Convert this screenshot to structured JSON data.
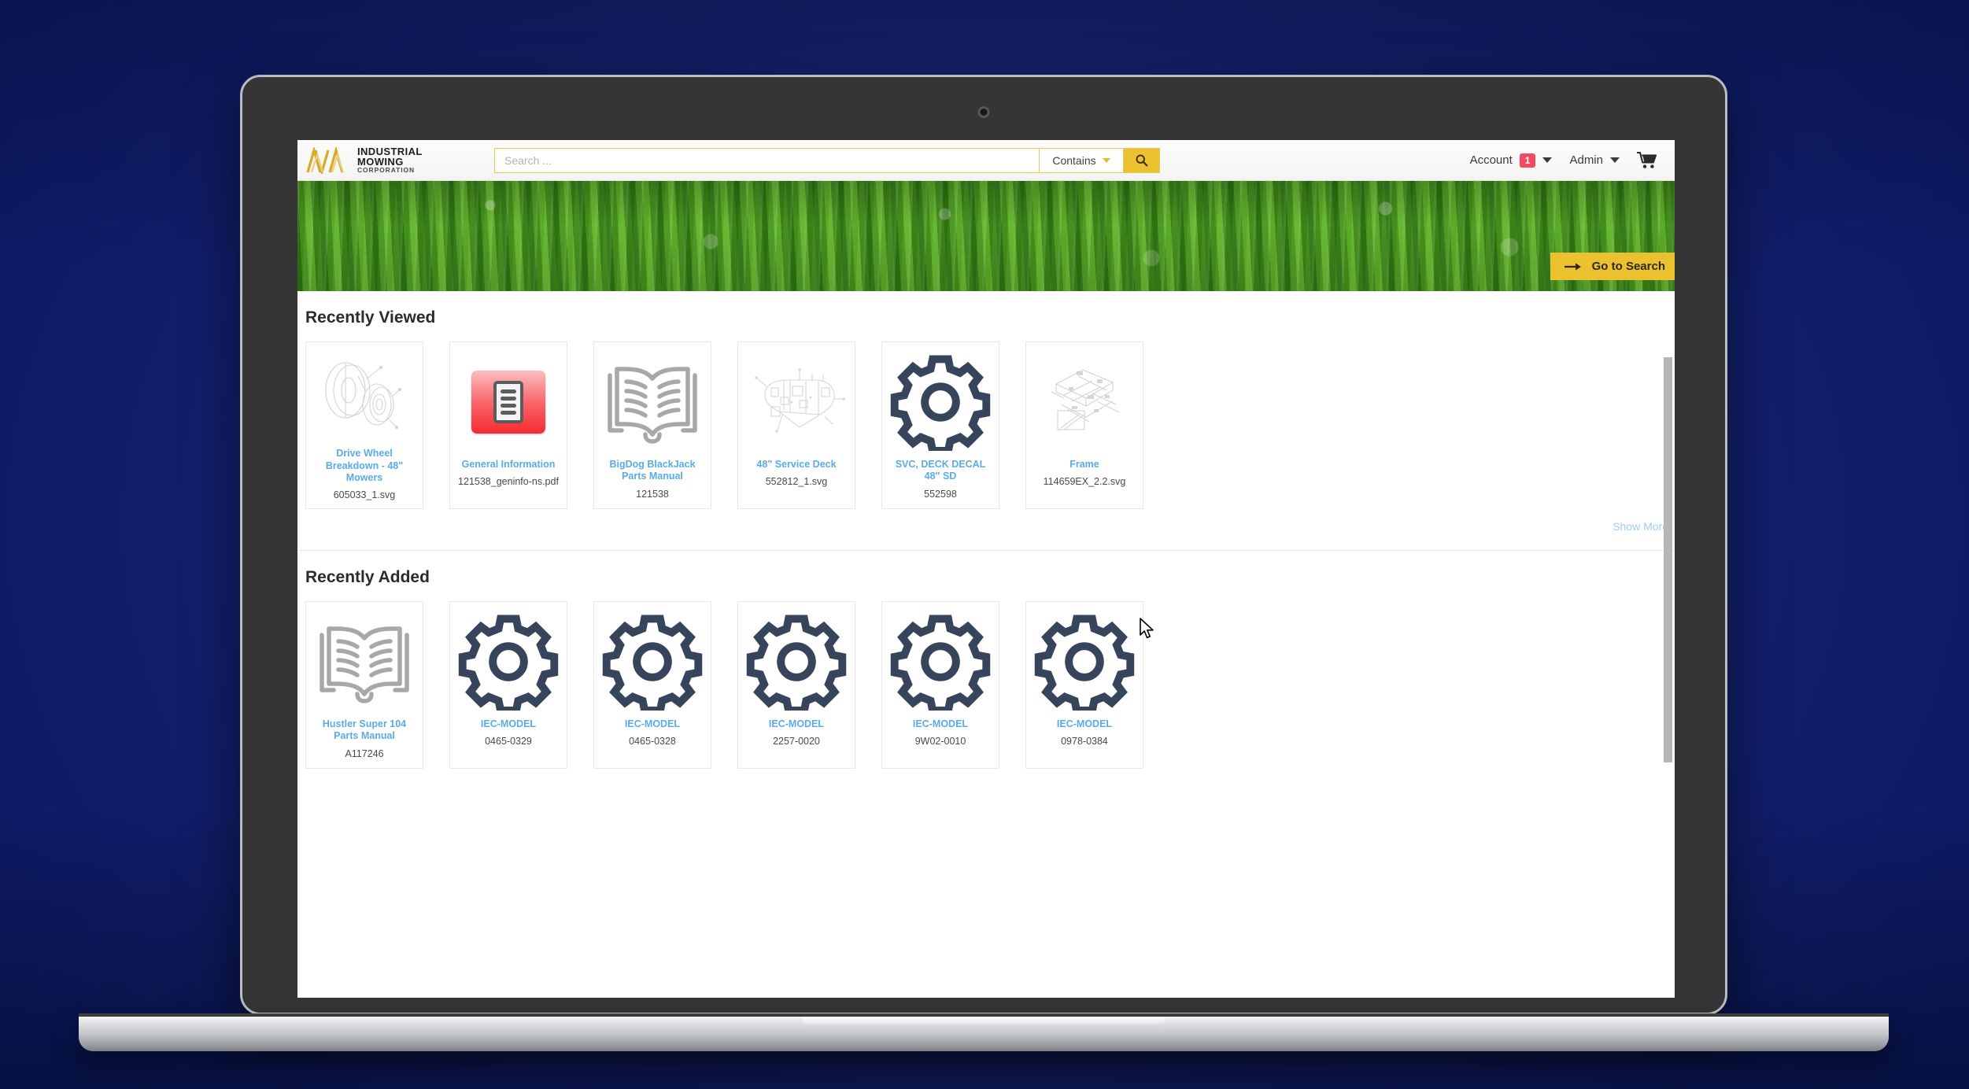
{
  "header": {
    "logo": {
      "line1": "INDUSTRIAL",
      "line2": "MOWING",
      "line3": "CORPORATION",
      "mark": "ava-chevrons-logo",
      "color": "#d9a92b"
    },
    "search": {
      "placeholder": "Search ...",
      "value": "",
      "match_mode": "Contains",
      "search_icon": "magnifier-icon",
      "accent": "#ecc12f"
    },
    "account": {
      "label": "Account",
      "badge": "1",
      "badge_color": "#f24a63"
    },
    "admin": {
      "label": "Admin"
    },
    "cart": {
      "icon": "shopping-cart-icon"
    }
  },
  "banner": {
    "image": "green-grass-dew-photo",
    "cta_label": "Go to Search",
    "cta_icon": "arrow-right-icon",
    "cta_color": "#ecc12f"
  },
  "sections": [
    {
      "title": "Recently Viewed",
      "show_more": "Show More",
      "cards": [
        {
          "title": "Drive Wheel Breakdown - 48\" Mowers",
          "sub": "605033_1.svg",
          "icon": "line-drawing-wheel"
        },
        {
          "title": "General Information",
          "sub": "121538_geninfo-ns.pdf",
          "icon": "pdf-document-icon"
        },
        {
          "title": "BigDog BlackJack Parts Manual",
          "sub": "121538",
          "icon": "open-book-icon"
        },
        {
          "title": "48\" Service Deck",
          "sub": "552812_1.svg",
          "icon": "line-drawing-deck"
        },
        {
          "title": "SVC, DECK DECAL 48\" SD",
          "sub": "552598",
          "icon": "gear-icon"
        },
        {
          "title": "Frame",
          "sub": "114659EX_2.2.svg",
          "icon": "line-drawing-frame"
        }
      ]
    },
    {
      "title": "Recently Added",
      "show_more": "",
      "cards": [
        {
          "title": "Hustler Super 104 Parts Manual",
          "sub": "A117246",
          "icon": "open-book-icon"
        },
        {
          "title": "IEC-MODEL",
          "sub": "0465-0329",
          "icon": "gear-icon"
        },
        {
          "title": "IEC-MODEL",
          "sub": "0465-0328",
          "icon": "gear-icon"
        },
        {
          "title": "IEC-MODEL",
          "sub": "2257-0020",
          "icon": "gear-icon"
        },
        {
          "title": "IEC-MODEL",
          "sub": "9W02-0010",
          "icon": "gear-icon"
        },
        {
          "title": "IEC-MODEL",
          "sub": "0978-0384",
          "icon": "gear-icon"
        }
      ]
    }
  ],
  "colors": {
    "link": "#5aabe8",
    "gear": "#36455c",
    "book": "#a8a8a8",
    "backdrop": "#13216f"
  }
}
